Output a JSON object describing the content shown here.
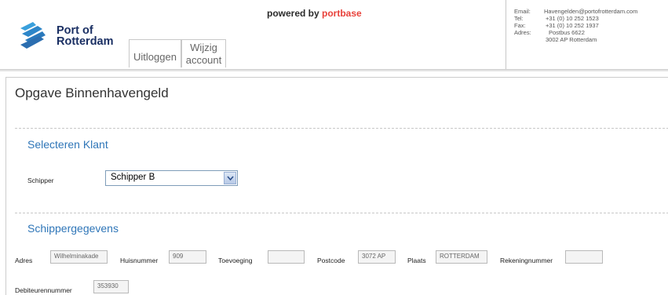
{
  "header": {
    "logo_line1": "Port of",
    "logo_line2": "Rotterdam",
    "powered_prefix": "powered by ",
    "powered_brand": "portbase",
    "tabs": [
      {
        "label": "Uitloggen"
      },
      {
        "label_line1": "Wijzig",
        "label_line2": "account"
      }
    ],
    "contact": [
      {
        "key": "Email:",
        "value": "Havengelden@portofrotterdam.com"
      },
      {
        "key": "Tel:",
        "value": "+31 (0) 10 252 1523"
      },
      {
        "key": "Fax:",
        "value": "+31 (0) 10 252 1937"
      },
      {
        "key": "Adres:",
        "value": "Postbus 6622"
      },
      {
        "key": "",
        "value": "3002 AP  Rotterdam"
      }
    ]
  },
  "page": {
    "title": "Opgave Binnenhavengeld"
  },
  "select_client": {
    "title": "Selecteren Klant",
    "schipper_label": "Schipper",
    "schipper_value": "Schipper B"
  },
  "schipper_details": {
    "title": "Schippergegevens",
    "fields": {
      "adres": {
        "label": "Adres",
        "value": "Wilhelminakade"
      },
      "huisnummer": {
        "label": "Huisnummer",
        "value": "909"
      },
      "toevoeging": {
        "label": "Toevoeging",
        "value": ""
      },
      "postcode": {
        "label": "Postcode",
        "value": "3072 AP"
      },
      "plaats": {
        "label": "Plaats",
        "value": "ROTTERDAM"
      },
      "rekeningnummer": {
        "label": "Rekeningnummer",
        "value": ""
      },
      "debiteurennummer": {
        "label": "Debiteurennummer",
        "value": "353930"
      }
    }
  },
  "colors": {
    "section_title": "#2f76b8",
    "logo": "#1a2f63",
    "portbase": "#e8413a"
  }
}
